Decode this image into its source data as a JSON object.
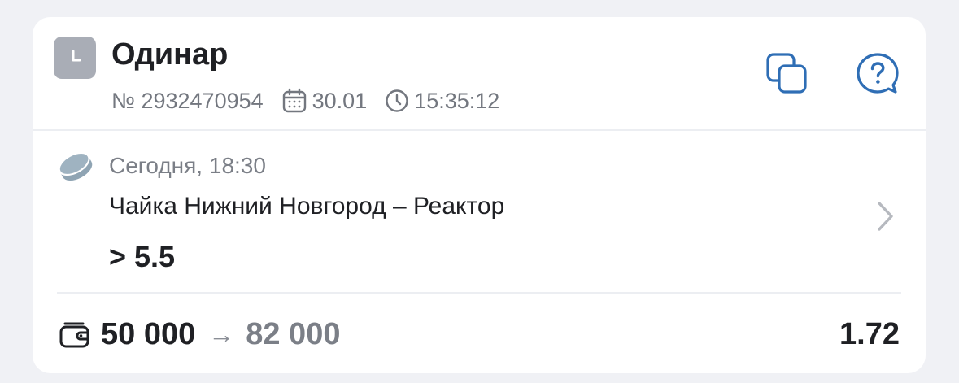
{
  "bet": {
    "type": "Одинар",
    "number": "№ 2932470954",
    "date": "30.01",
    "time": "15:35:12",
    "status_icon": "clock-icon"
  },
  "actions": {
    "copy_icon": "copy-icon",
    "help_icon": "help-icon"
  },
  "event": {
    "sport_icon": "hockey-puck-icon",
    "start": "Сегодня, 18:30",
    "teams": "Чайка Нижний Новгород – Реактор",
    "outcome": "> 5.5"
  },
  "footer": {
    "stake": "50 000",
    "arrow": "→",
    "payout": "82 000",
    "odds": "1.72"
  },
  "colors": {
    "accent": "#2f6eb5",
    "badge": "#a9adb6",
    "text_primary": "#1f2024",
    "text_secondary": "#73777f"
  }
}
